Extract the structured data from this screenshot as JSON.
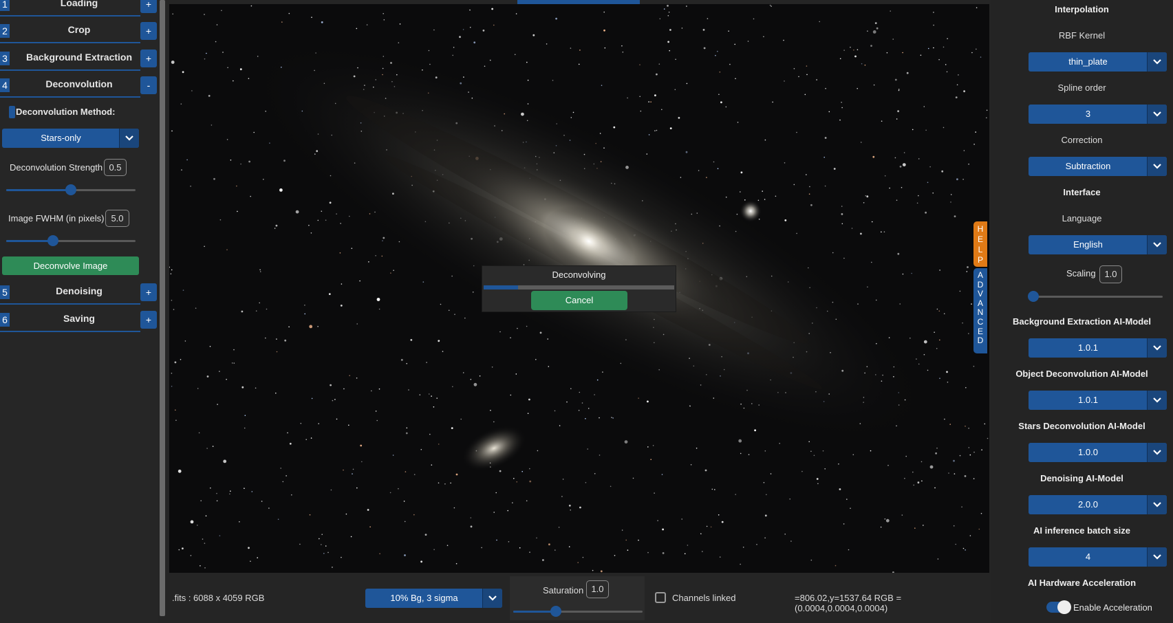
{
  "left_panel": {
    "sections": [
      {
        "num": "1",
        "title": "Loading",
        "toggle": "+"
      },
      {
        "num": "2",
        "title": "Crop",
        "toggle": "+"
      },
      {
        "num": "3",
        "title": "Background Extraction",
        "toggle": "+"
      },
      {
        "num": "4",
        "title": "Deconvolution",
        "toggle": "-"
      },
      {
        "num": "5",
        "title": "Denoising",
        "toggle": "+"
      },
      {
        "num": "6",
        "title": "Saving",
        "toggle": "+"
      }
    ],
    "deconvolution": {
      "method_label": "Deconvolution Method:",
      "method_value": "Stars-only",
      "strength_label": "Deconvolution Strength",
      "strength_value": "0.5",
      "strength_fraction": 0.5,
      "fwhm_label": "Image FWHM (in pixels)",
      "fwhm_value": "5.0",
      "fwhm_fraction": 0.36,
      "deconvolve_button": "Deconvolve Image"
    }
  },
  "dialog": {
    "title": "Deconvolving",
    "progress": 0.18,
    "cancel_label": "Cancel"
  },
  "side_tabs": {
    "help": [
      "H",
      "E",
      "L",
      "P"
    ],
    "advanced": [
      "A",
      "D",
      "V",
      "A",
      "N",
      "C",
      "E",
      "D"
    ]
  },
  "bottom_bar": {
    "file_info": ".fits : 6088 x 4059 RGB",
    "stretch_value": "10% Bg, 3 sigma",
    "saturation_label": "Saturation",
    "saturation_value": "1.0",
    "saturation_fraction": 0.33,
    "channels_linked_label": "Channels linked",
    "channels_linked": false,
    "coords": "=806.02,y=1537.64  RGB = (0.0004,0.0004,0.0004)"
  },
  "right_panel": {
    "interpolation_heading": "Interpolation",
    "rbf_kernel_label": "RBF Kernel",
    "rbf_kernel_value": "thin_plate",
    "spline_order_label": "Spline order",
    "spline_order_value": "3",
    "correction_label": "Correction",
    "correction_value": "Subtraction",
    "interface_heading": "Interface",
    "language_label": "Language",
    "language_value": "English",
    "scaling_label": "Scaling",
    "scaling_value": "1.0",
    "scaling_fraction": 0.0,
    "bg_model_heading": "Background Extraction AI-Model",
    "bg_model_value": "1.0.1",
    "obj_deconv_heading": "Object Deconvolution AI-Model",
    "obj_deconv_value": "1.0.1",
    "stars_deconv_heading": "Stars Deconvolution AI-Model",
    "stars_deconv_value": "1.0.0",
    "denoise_heading": "Denoising AI-Model",
    "denoise_value": "2.0.0",
    "batch_heading": "AI inference batch size",
    "batch_value": "4",
    "hw_heading": "AI Hardware Acceleration",
    "acceleration_label": "Enable Acceleration",
    "acceleration_enabled": true
  },
  "colors": {
    "accent": "#1f5699",
    "button_green": "#2e8b57",
    "help_tab": "#e07a16",
    "panel_bg": "#262626"
  }
}
